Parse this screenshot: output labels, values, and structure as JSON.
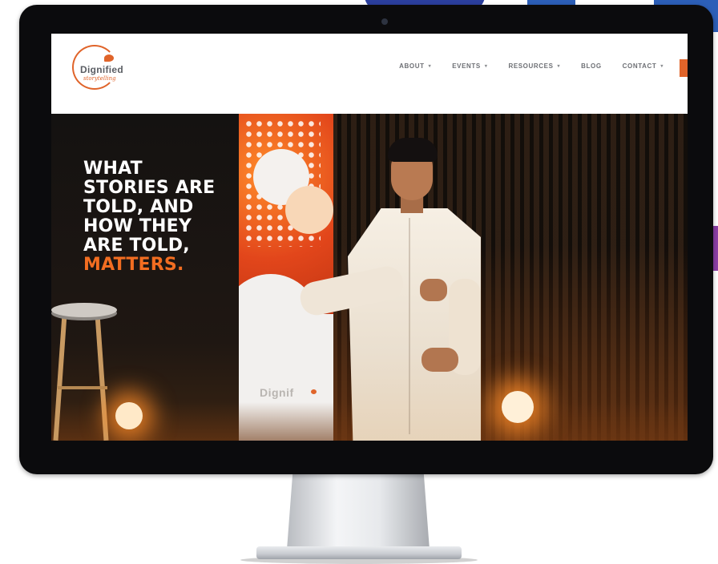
{
  "site": {
    "logo": {
      "wordmark": "Dignified",
      "tagline": "storytelling"
    },
    "nav": [
      {
        "label": "ABOUT",
        "has_dropdown": true
      },
      {
        "label": "EVENTS",
        "has_dropdown": true
      },
      {
        "label": "RESOURCES",
        "has_dropdown": true
      },
      {
        "label": "BLOG",
        "has_dropdown": false
      },
      {
        "label": "CONTACT",
        "has_dropdown": true
      }
    ],
    "caret": "▾"
  },
  "hero": {
    "headline_lines": [
      "WHAT",
      "STORIES ARE",
      "TOLD, AND",
      "HOW THEY",
      "ARE TOLD,"
    ],
    "headline_accent": "MATTERS.",
    "banner_logo": "Dignif"
  },
  "colors": {
    "accent": "#f26d21",
    "brand_orange": "#e0642a",
    "nav_text": "#6d6f74",
    "headline": "#ffffff"
  },
  "icons": [
    "monitor-camera-icon",
    "dropdown-caret-icon",
    "speech-bubble-icon"
  ]
}
